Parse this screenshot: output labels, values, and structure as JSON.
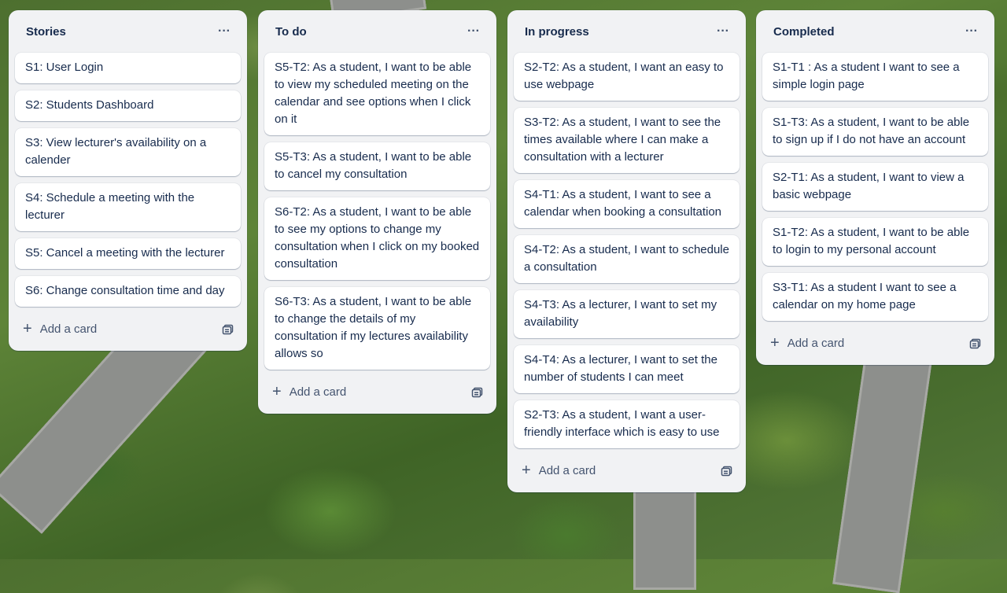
{
  "lists": [
    {
      "title": "Stories",
      "menu": "···",
      "cards": [
        "S1: User Login",
        "S2: Students Dashboard",
        "S3: View lecturer's availability on a calender",
        "S4: Schedule a meeting with the lecturer",
        "S5: Cancel a meeting with the lecturer",
        "S6: Change consultation time and day"
      ],
      "add_card": "Add a card"
    },
    {
      "title": "To do",
      "menu": "···",
      "cards": [
        "S5-T2: As a student, I want to be able to view my scheduled meeting on the calendar and see options when I click on it",
        "S5-T3: As a student, I want to be able to cancel my consultation",
        "S6-T2: As a student, I want to be able to see my options to change my consultation when I click on my booked consultation",
        "S6-T3: As a student, I want to be able to change the details of my consultation if my lectures availability allows so"
      ],
      "add_card": "Add a card"
    },
    {
      "title": "In progress",
      "menu": "···",
      "cards": [
        "S2-T2: As a student, I want an easy to use webpage",
        "S3-T2: As a student, I want to see the times available where I can make a consultation with a lecturer",
        "S4-T1: As a student, I want to see a calendar when booking a consultation",
        "S4-T2: As a student, I want to schedule a consultation",
        "S4-T3: As a lecturer, I want to set my availability",
        "S4-T4: As a lecturer, I want to set the number of students I can meet",
        "S2-T3: As a student, I want a user-friendly interface which is easy to use"
      ],
      "add_card": "Add a card"
    },
    {
      "title": "Completed",
      "menu": "···",
      "cards": [
        "S1-T1 : As a student I want to see a simple login page",
        "S1-T3: As a student, I want to be able to sign up if I do not have an account",
        "S2-T1: As a student, I want to view a basic webpage",
        "S1-T2: As a student, I want to be able to login to my personal account",
        "S3-T1: As a student I want to see a calendar on my home page"
      ],
      "add_card": "Add a card"
    }
  ],
  "icons": {
    "menu": "more-icon",
    "add": "plus-icon",
    "template": "card-template-icon"
  },
  "colors": {
    "list_bg": "#f1f2f4",
    "card_bg": "#ffffff",
    "text": "#172b4d",
    "subtle_text": "#44546f"
  }
}
